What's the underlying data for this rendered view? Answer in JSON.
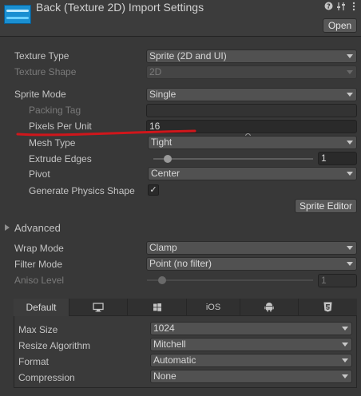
{
  "header": {
    "title": "Back (Texture 2D) Import Settings",
    "open_label": "Open",
    "help_icon": "help-icon",
    "preset_icon": "preset-icon",
    "menu_icon": "kebab-menu-icon"
  },
  "settings": {
    "texture_type": {
      "label": "Texture Type",
      "value": "Sprite (2D and UI)"
    },
    "texture_shape": {
      "label": "Texture Shape",
      "value": "2D"
    },
    "sprite_mode": {
      "label": "Sprite Mode",
      "value": "Single"
    },
    "packing_tag": {
      "label": "Packing Tag",
      "value": ""
    },
    "pixels_per_unit": {
      "label": "Pixels Per Unit",
      "value": "16"
    },
    "mesh_type": {
      "label": "Mesh Type",
      "value": "Tight"
    },
    "extrude_edges": {
      "label": "Extrude Edges",
      "value": "1",
      "fraction": 0.09
    },
    "pivot": {
      "label": "Pivot",
      "value": "Center"
    },
    "generate_physics_shape": {
      "label": "Generate Physics Shape",
      "checked": true,
      "check_glyph": "✓"
    },
    "sprite_editor_label": "Sprite Editor"
  },
  "advanced": {
    "label": "Advanced"
  },
  "wrap_filter": {
    "wrap_mode": {
      "label": "Wrap Mode",
      "value": "Clamp"
    },
    "filter_mode": {
      "label": "Filter Mode",
      "value": "Point (no filter)"
    },
    "aniso_level": {
      "label": "Aniso Level",
      "value": "1",
      "fraction": 0.09
    }
  },
  "platform_tabs": [
    {
      "label": "Default",
      "icon": ""
    },
    {
      "label": "",
      "icon": "monitor-icon"
    },
    {
      "label": "",
      "icon": "windows-icon"
    },
    {
      "label": "iOS",
      "icon": ""
    },
    {
      "label": "",
      "icon": "android-icon"
    },
    {
      "label": "",
      "icon": "html5-icon"
    }
  ],
  "platform": {
    "max_size": {
      "label": "Max Size",
      "value": "1024"
    },
    "resize_algorithm": {
      "label": "Resize Algorithm",
      "value": "Mitchell"
    },
    "format": {
      "label": "Format",
      "value": "Automatic"
    },
    "compression": {
      "label": "Compression",
      "value": "None"
    }
  },
  "colors": {
    "annotation_red": "#d0161b",
    "background": "#383838"
  }
}
